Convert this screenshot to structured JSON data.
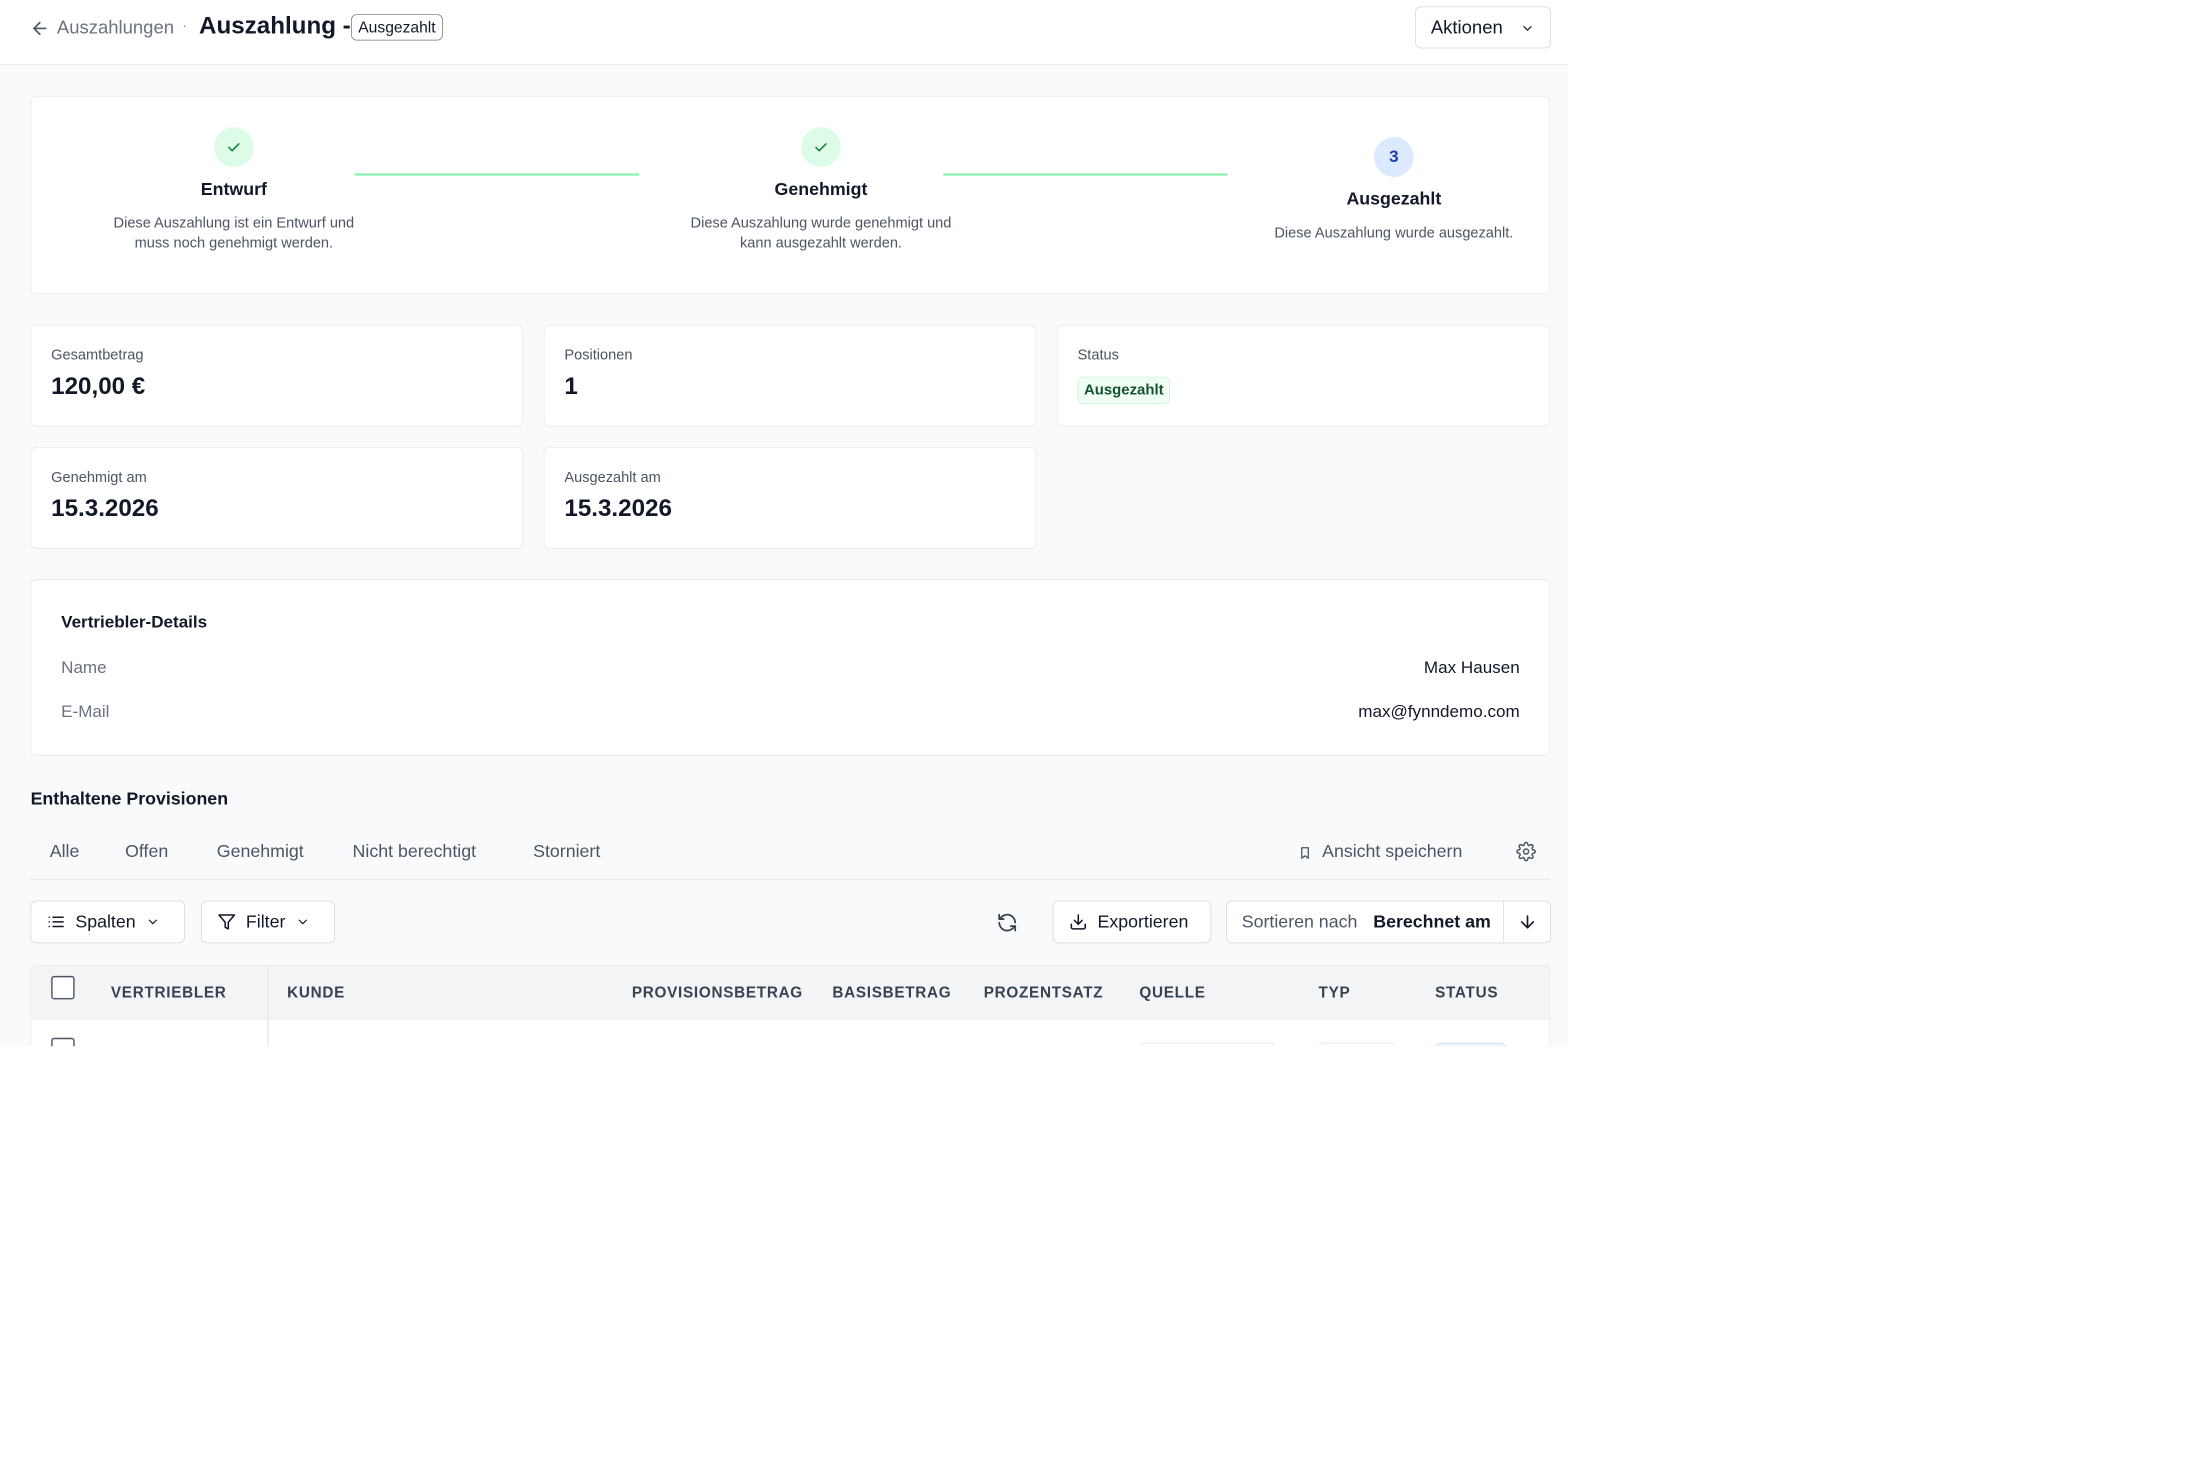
{
  "header": {
    "breadcrumb": "Auszahlungen",
    "separator": "·",
    "title": "Auszahlung -",
    "title_badge": "Ausgezahlt",
    "actions_label": "Aktionen"
  },
  "stepper": {
    "steps": [
      {
        "title": "Entwurf",
        "description": "Diese Auszahlung ist ein Entwurf und muss noch genehmigt werden.",
        "state": "done"
      },
      {
        "title": "Genehmigt",
        "description": "Diese Auszahlung wurde genehmigt und kann ausgezahlt werden.",
        "state": "done"
      },
      {
        "number": "3",
        "title": "Ausgezahlt",
        "description": "Diese Auszahlung wurde ausgezahlt.",
        "state": "current"
      }
    ]
  },
  "stats": {
    "total": {
      "label": "Gesamtbetrag",
      "value": "120,00 €"
    },
    "positions": {
      "label": "Positionen",
      "value": "1"
    },
    "status": {
      "label": "Status",
      "value": "Ausgezahlt"
    },
    "approved": {
      "label": "Genehmigt am",
      "value": "15.3.2026"
    },
    "paid": {
      "label": "Ausgezahlt am",
      "value": "15.3.2026"
    }
  },
  "details": {
    "title": "Vertriebler-Details",
    "name_label": "Name",
    "name_value": "Max Hausen",
    "email_label": "E-Mail",
    "email_value": "max@fynndemo.com"
  },
  "commissions": {
    "title": "Enthaltene Provisionen",
    "tabs": [
      "Alle",
      "Offen",
      "Genehmigt",
      "Nicht berechtigt",
      "Storniert"
    ],
    "save_view_label": "Ansicht speichern",
    "columns_label": "Spalten",
    "filter_label": "Filter",
    "export_label": "Exportieren",
    "sort_label": "Sortieren nach",
    "sort_value": "Berechnet am",
    "table_headers": [
      "VERTRIEBLER",
      "KUNDE",
      "PROVISIONSBETRAG",
      "BASISBETRAG",
      "PROZENTSATZ",
      "QUELLE",
      "TYP",
      "STATUS"
    ]
  },
  "colors": {
    "success_bg": "#dcfce7",
    "success_text": "#14532d",
    "connector": "#86efac",
    "current_bg": "#dbeafe",
    "current_text": "#1e40af"
  },
  "icons": [
    "arrow-left-icon",
    "chevron-down-icon",
    "check-icon",
    "bookmark-icon",
    "gear-icon",
    "list-icon",
    "filter-icon",
    "refresh-icon",
    "download-icon",
    "arrow-down-icon"
  ]
}
